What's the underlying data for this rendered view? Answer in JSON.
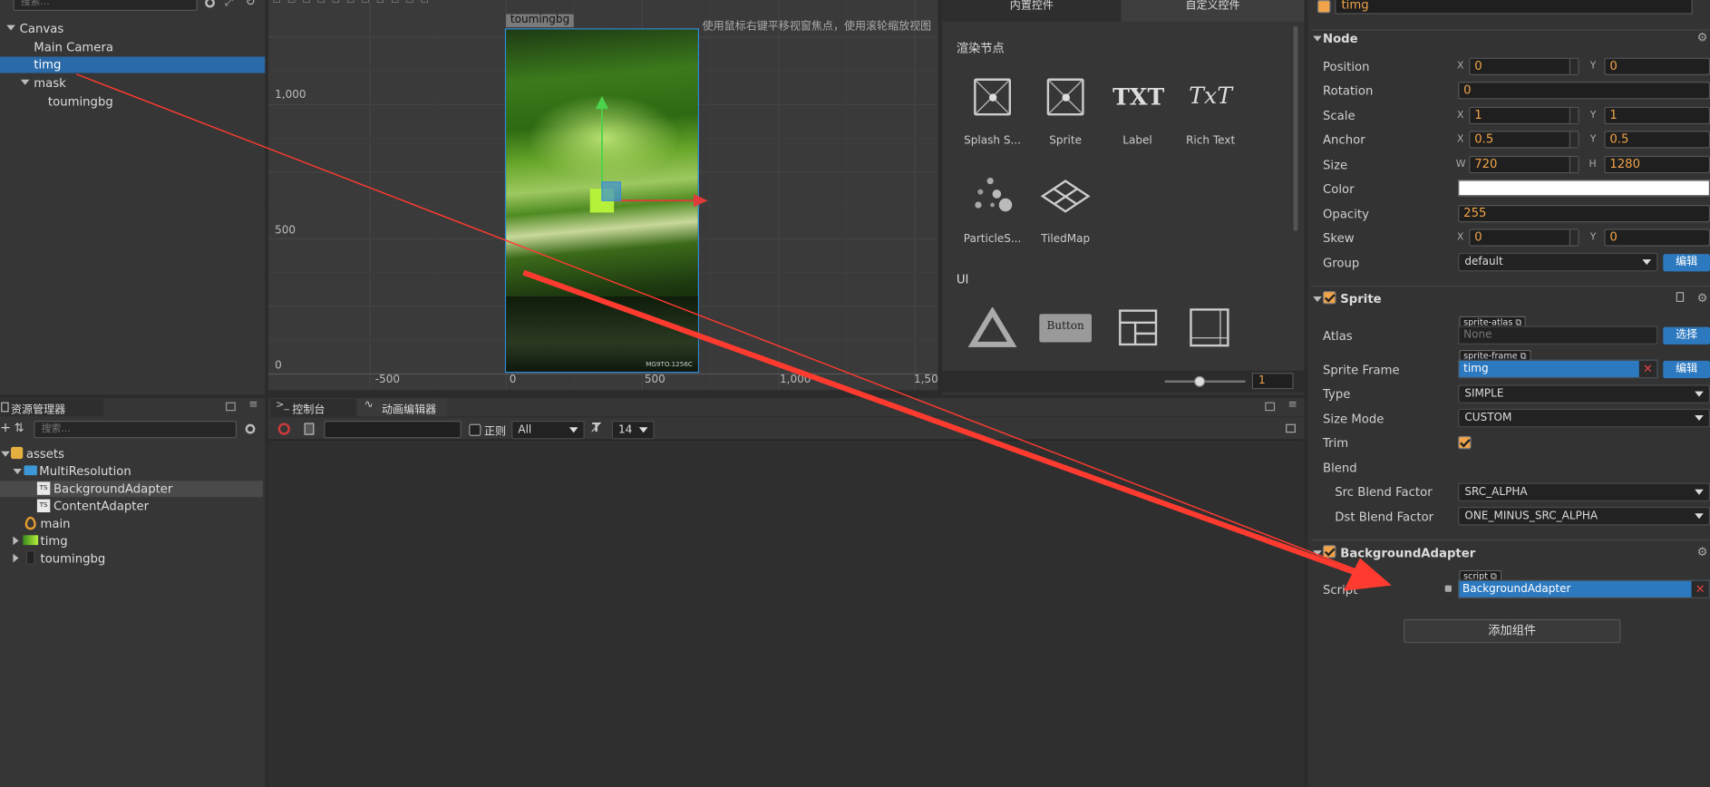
{
  "hierarchy": {
    "search_placeholder": "搜索...",
    "nodes": [
      "Canvas",
      "Main Camera",
      "timg",
      "mask",
      "toumingbg"
    ]
  },
  "scene": {
    "tag": "toumingbg",
    "hint": "使用鼠标右键平移视窗焦点，使用滚轮缩放视图",
    "watermark": "MG9TO.1256C",
    "y_ticks": [
      "1,000",
      "500",
      "0"
    ],
    "x_ticks": [
      "-500",
      "0",
      "500",
      "1,000",
      "1,50"
    ]
  },
  "controls": {
    "tabs": [
      "内置控件",
      "自定义控件"
    ],
    "render_section": "渲染节点",
    "render_items": [
      "Splash S...",
      "Sprite",
      "Label",
      "Rich Text",
      "ParticleS...",
      "TiledMap"
    ],
    "label_glyph": "TXT",
    "richtext_glyph": "TxT",
    "ui_section": "UI",
    "button_glyph": "Button",
    "zoom_value": "1"
  },
  "assets": {
    "title": "资源管理器",
    "search_placeholder": "搜索...",
    "items": [
      "assets",
      "MultiResolution",
      "BackgroundAdapter",
      "ContentAdapter",
      "main",
      "timg",
      "toumingbg"
    ],
    "ts_badge": "TS"
  },
  "console": {
    "tab_console": "控制台",
    "tab_anim": "动画编辑器",
    "regex_label": "正则",
    "filter_value": "All",
    "font_size": "14"
  },
  "inspector": {
    "node_name": "timg",
    "node_section": "Node",
    "position_label": "Position",
    "position_x": "0",
    "position_y": "0",
    "rotation_label": "Rotation",
    "rotation": "0",
    "scale_label": "Scale",
    "scale_x": "1",
    "scale_y": "1",
    "anchor_label": "Anchor",
    "anchor_x": "0.5",
    "anchor_y": "0.5",
    "size_label": "Size",
    "size_w": "720",
    "size_h": "1280",
    "color_label": "Color",
    "opacity_label": "Opacity",
    "opacity": "255",
    "skew_label": "Skew",
    "skew_x": "0",
    "skew_y": "0",
    "group_label": "Group",
    "group": "default",
    "edit_label": "编辑",
    "x_letter": "X",
    "y_letter": "Y",
    "w_letter": "W",
    "h_letter": "H",
    "sprite_section": "Sprite",
    "atlas_label": "Atlas",
    "atlas_tag": "sprite-atlas",
    "atlas_value": "None",
    "select_label": "选择",
    "frame_label": "Sprite Frame",
    "frame_tag": "sprite-frame",
    "frame_value": "timg",
    "type_label": "Type",
    "type": "SIMPLE",
    "sizemode_label": "Size Mode",
    "sizemode": "CUSTOM",
    "trim_label": "Trim",
    "blend_label": "Blend",
    "src_blend_label": "Src Blend Factor",
    "src_blend": "SRC_ALPHA",
    "dst_blend_label": "Dst Blend Factor",
    "dst_blend": "ONE_MINUS_SRC_ALPHA",
    "bg_section": "BackgroundAdapter",
    "script_label": "Script",
    "script_tag": "script",
    "script_value": "BackgroundAdapter",
    "add_component": "添加组件"
  },
  "colors": {
    "accent": "#2c79c0",
    "selection": "#2a6aa9",
    "value": "#f0a34a",
    "arrow": "#ff3b30"
  }
}
